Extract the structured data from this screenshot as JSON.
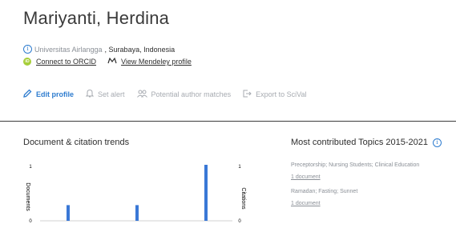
{
  "profile": {
    "name": "Mariyanti, Herdina",
    "institution": "Universitas Airlangga",
    "location": ", Surabaya, Indonesia",
    "orcid_label": "Connect to ORCID",
    "mendeley_label": "View Mendeley profile"
  },
  "actions": [
    {
      "label": "Edit profile",
      "icon": "pencil-icon"
    },
    {
      "label": "Set alert",
      "icon": "bell-icon"
    },
    {
      "label": "Potential author matches",
      "icon": "people-icon"
    },
    {
      "label": "Export to SciVal",
      "icon": "export-icon"
    }
  ],
  "trends": {
    "title": "Document & citation trends"
  },
  "topics": {
    "title": "Most contributed Topics 2015-2021",
    "items": [
      {
        "name": "Preceptorship; Nursing Students; Clinical Education",
        "docs": "1 document"
      },
      {
        "name": "Ramadan; Fasting; Sunnet",
        "docs": "1 document"
      }
    ]
  },
  "colors": {
    "accent": "#2e7ccf",
    "bar": "#3a78d6",
    "orcid": "#a6ce39",
    "muted": "#a7abb1"
  },
  "chart_data": {
    "type": "bar",
    "title": "Document & citation trends",
    "ylabel_left": "Documents",
    "ylabel_right": "Citations",
    "yticks_left": [
      "1",
      "0"
    ],
    "yticks_right": [
      "1",
      "0"
    ],
    "ylim_left": [
      0,
      1
    ],
    "ylim_right": [
      0,
      1
    ],
    "series": [
      {
        "type": "bar",
        "values": [
          0.28,
          0.28,
          1
        ]
      }
    ],
    "grid": false
  }
}
